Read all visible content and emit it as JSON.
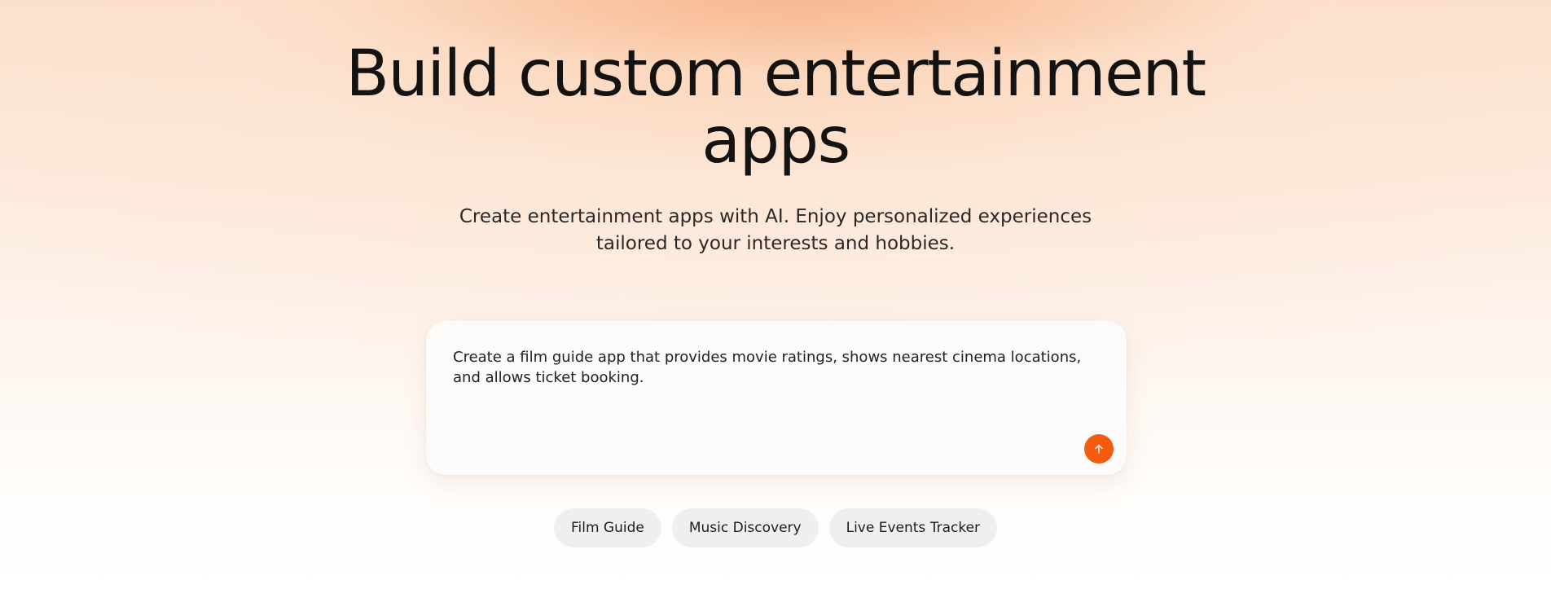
{
  "hero": {
    "title_line1": "Build custom entertainment",
    "title_line2": "apps",
    "subtitle_line1": "Create entertainment apps with AI. Enjoy personalized experiences",
    "subtitle_line2": "tailored to your interests and hobbies."
  },
  "prompt": {
    "value": "Create a film guide app that provides movie ratings, shows nearest cinema locations, and allows ticket booking.",
    "submit_icon": "arrow-up-icon",
    "accent_color": "#f45b0e"
  },
  "suggestions": [
    {
      "label": "Film Guide"
    },
    {
      "label": "Music Discovery"
    },
    {
      "label": "Live Events Tracker"
    }
  ]
}
